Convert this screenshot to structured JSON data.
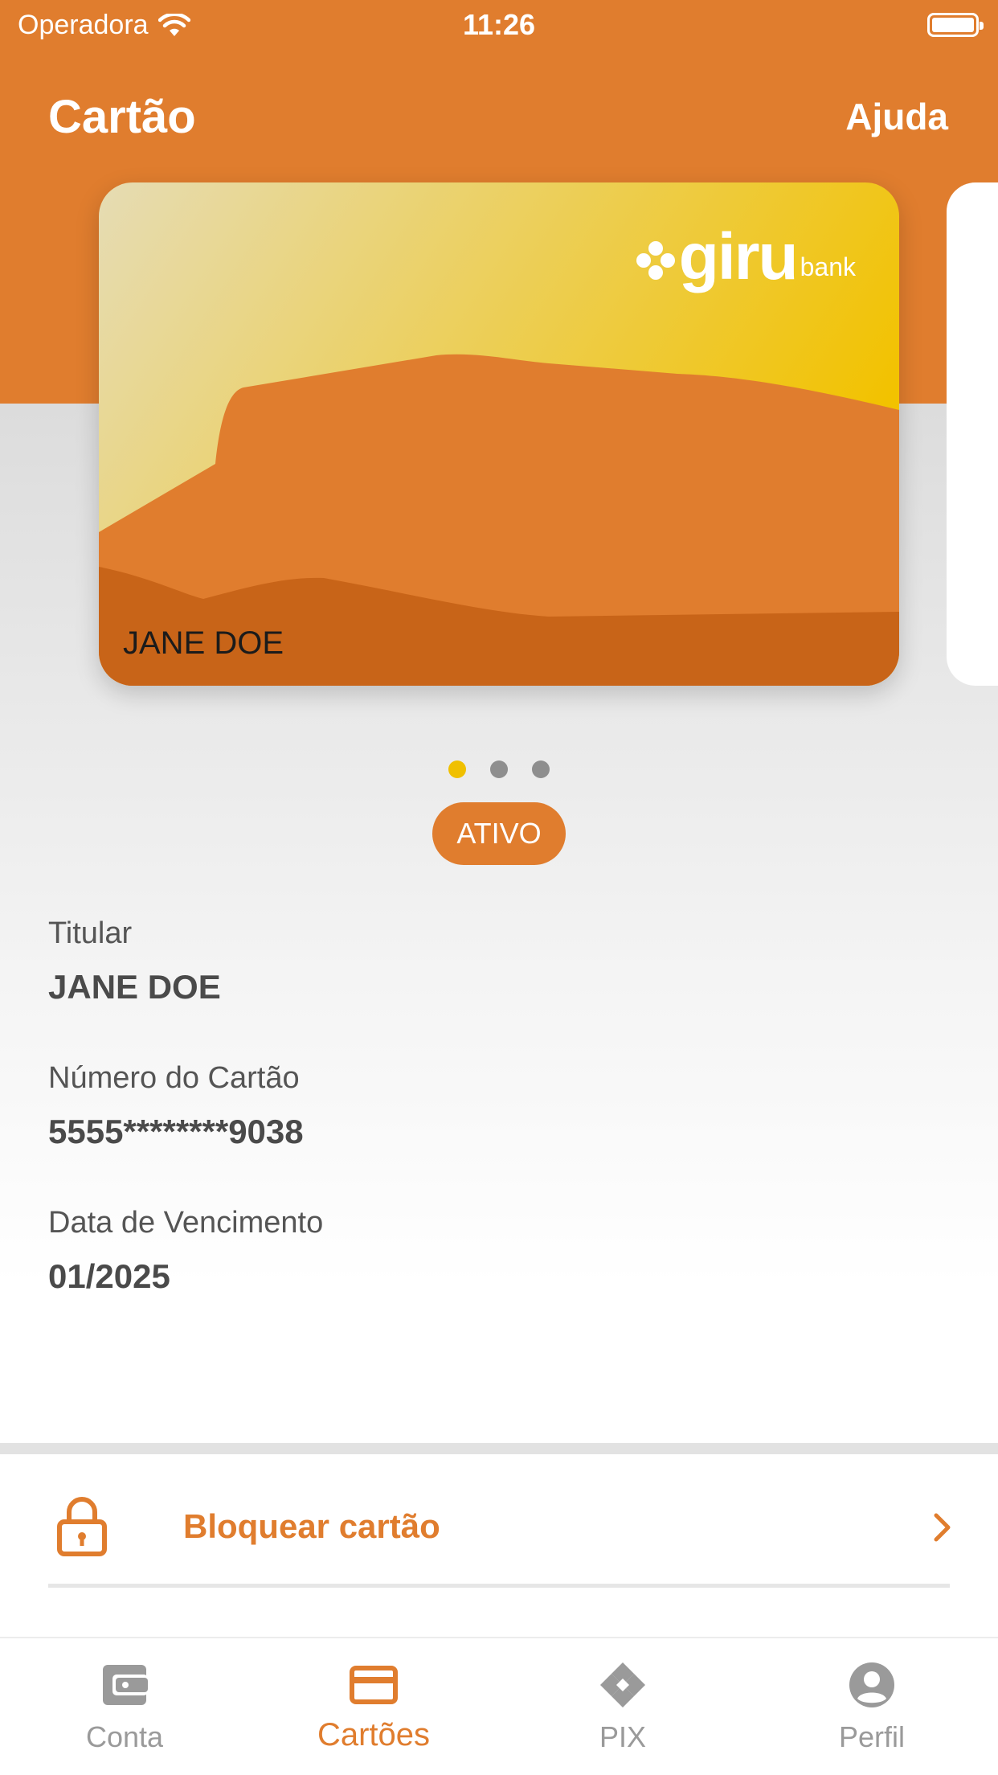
{
  "status_bar": {
    "carrier": "Operadora",
    "time": "11:26"
  },
  "header": {
    "title": "Cartão",
    "help_label": "Ajuda"
  },
  "card": {
    "brand_main": "giru",
    "brand_sub": "bank",
    "holder_name": "JANE DOE",
    "colors": {
      "gradient_start": "#e6dcb4",
      "gradient_end": "#f2c200",
      "mountain": "#e07d2e",
      "ground": "#c86418"
    }
  },
  "pagination": {
    "total": 3,
    "active_index": 0
  },
  "status_badge": "ATIVO",
  "details": {
    "holder_label": "Titular",
    "holder_value": "JANE DOE",
    "number_label": "Número do Cartão",
    "number_value": "5555********9038",
    "expiry_label": "Data de Vencimento",
    "expiry_value": "01/2025"
  },
  "actions": {
    "block_card_label": "Bloquear cartão"
  },
  "tabbar": {
    "items": [
      {
        "label": "Conta",
        "icon": "wallet-icon"
      },
      {
        "label": "Cartões",
        "icon": "credit-card-icon"
      },
      {
        "label": "PIX",
        "icon": "pix-icon"
      },
      {
        "label": "Perfil",
        "icon": "user-icon"
      }
    ],
    "active_index": 1
  },
  "colors": {
    "primary": "#e07d2e",
    "accent_yellow": "#f0c000",
    "text_gray": "#4a4a4a"
  }
}
